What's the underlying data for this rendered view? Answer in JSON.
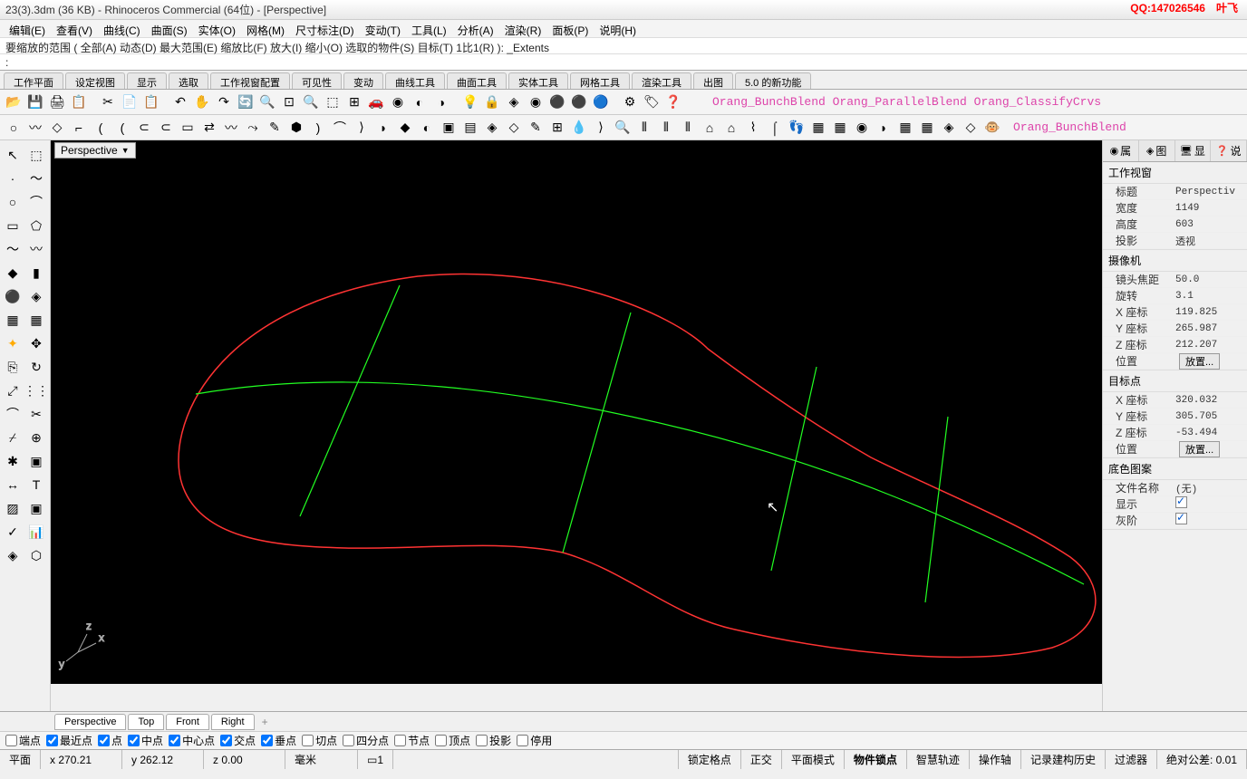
{
  "title": "23(3).3dm (36 KB) - Rhinoceros Commercial (64位) - [Perspective]",
  "watermark_qq": "QQ:147026546",
  "watermark_name": "叶飞",
  "menu": [
    "编辑(E)",
    "查看(V)",
    "曲线(C)",
    "曲面(S)",
    "实体(O)",
    "网格(M)",
    "尺寸标注(D)",
    "变动(T)",
    "工具(L)",
    "分析(A)",
    "渲染(R)",
    "面板(P)",
    "说明(H)"
  ],
  "cmd_history": "要缩放的范围 ( 全部(A)  动态(D)  最大范围(E)  缩放比(F)  放大(I)  缩小(O)  选取的物件(S)  目标(T)  1比1(R) ): _Extents",
  "cmd_prompt": ":",
  "tabs": [
    "工作平面",
    "设定视图",
    "显示",
    "选取",
    "工作视窗配置",
    "可见性",
    "变动",
    "曲线工具",
    "曲面工具",
    "实体工具",
    "网格工具",
    "渲染工具",
    "出图",
    "5.0 的新功能"
  ],
  "tool_text1": "Orang_BunchBlend Orang_ParallelBlend Orang_ClassifyCrvs",
  "tool_text2": "Orang_BunchBlend",
  "viewport_name": "Perspective",
  "right_tabs": [
    "属",
    "图",
    "显",
    "说"
  ],
  "props": {
    "vp_hdr": "工作视窗",
    "title_k": "标题",
    "title_v": "Perspectiv",
    "width_k": "宽度",
    "width_v": "1149",
    "height_k": "高度",
    "height_v": "603",
    "proj_k": "投影",
    "proj_v": "透视",
    "cam_hdr": "摄像机",
    "focal_k": "镜头焦距",
    "focal_v": "50.0",
    "rot_k": "旋转",
    "rot_v": "3.1",
    "cx_k": "X 座标",
    "cx_v": "119.825",
    "cy_k": "Y 座标",
    "cy_v": "265.987",
    "cz_k": "Z 座标",
    "cz_v": "212.207",
    "pos_k": "位置",
    "pos_btn": "放置...",
    "tgt_hdr": "目标点",
    "tx_k": "X 座标",
    "tx_v": "320.032",
    "ty_k": "Y 座标",
    "ty_v": "305.705",
    "tz_k": "Z 座标",
    "tz_v": "-53.494",
    "pos2_k": "位置",
    "pos2_btn": "放置...",
    "wp_hdr": "底色图案",
    "file_k": "文件名称",
    "file_v": "(无)",
    "show_k": "显示",
    "gray_k": "灰阶"
  },
  "view_tabs": [
    "Perspective",
    "Top",
    "Front",
    "Right"
  ],
  "osnap": {
    "end": "端点",
    "near": "最近点",
    "pt": "点",
    "mid": "中点",
    "cen": "中心点",
    "int": "交点",
    "perp": "垂点",
    "tan": "切点",
    "quad": "四分点",
    "knot": "节点",
    "vert": "顶点",
    "proj": "投影",
    "off": "停用"
  },
  "status": {
    "cplane": "平面",
    "x": "x 270.21",
    "y": "y 262.12",
    "z": "z 0.00",
    "unit": "毫米",
    "layer": "1",
    "gridsnap": "锁定格点",
    "ortho": "正交",
    "planar": "平面模式",
    "osnap": "物件锁点",
    "strack": "智慧轨迹",
    "gumball": "操作轴",
    "rechist": "记录建构历史",
    "filter": "过滤器",
    "tol": "绝对公差: 0.01"
  }
}
